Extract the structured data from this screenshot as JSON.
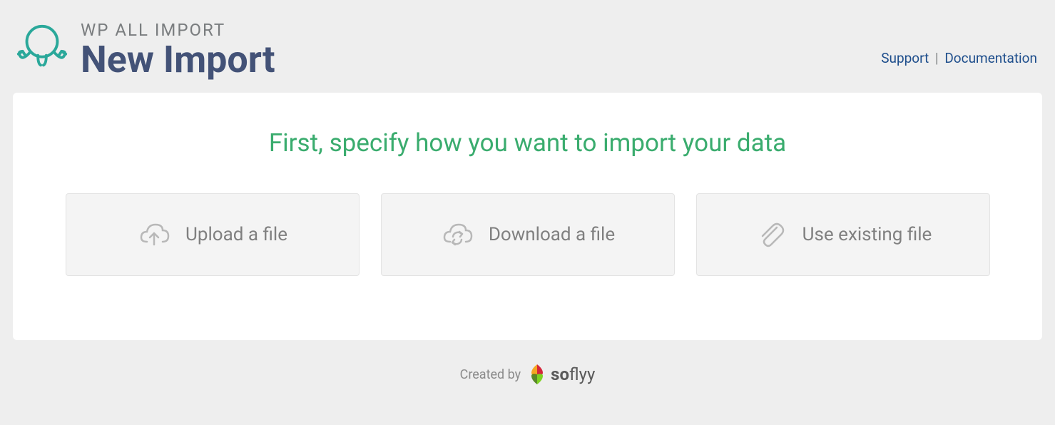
{
  "header": {
    "subtitle": "WP ALL IMPORT",
    "title": "New Import",
    "links": {
      "support": "Support",
      "documentation": "Documentation"
    }
  },
  "card": {
    "heading": "First, specify how you want to import your data",
    "options": [
      {
        "label": "Upload a file",
        "icon": "cloud-upload"
      },
      {
        "label": "Download a file",
        "icon": "cloud-download"
      },
      {
        "label": "Use existing file",
        "icon": "paperclip"
      }
    ]
  },
  "footer": {
    "created_by": "Created by",
    "brand_bold": "so",
    "brand_rest": "flyy"
  }
}
